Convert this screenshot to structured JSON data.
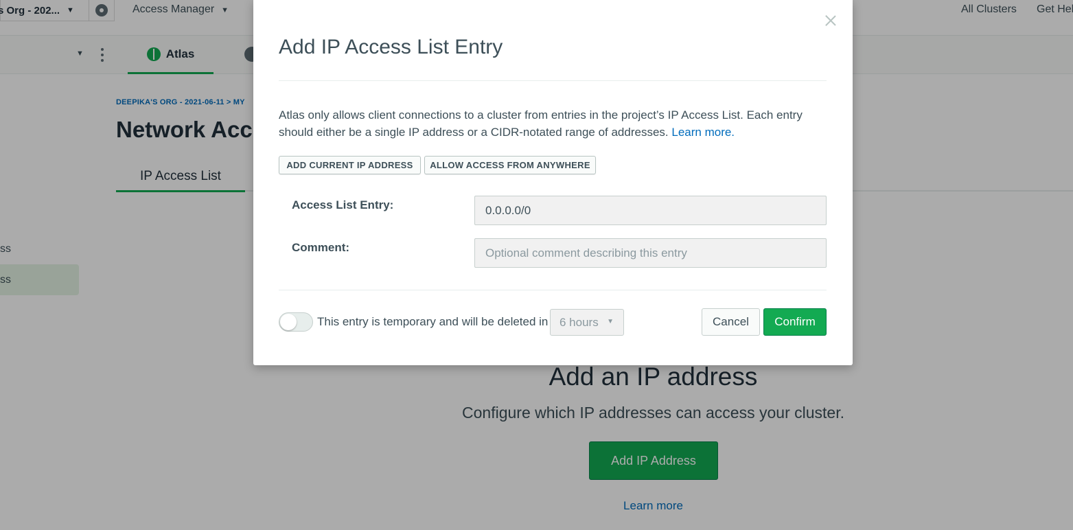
{
  "topbar": {
    "org_name": "s Org - 202...",
    "access_manager": "Access Manager",
    "all_clusters": "All Clusters",
    "get_help": "Get Hel"
  },
  "subnav": {
    "atlas_tab": "Atlas"
  },
  "page": {
    "breadcrumb": "DEEPIKA'S ORG - 2021-06-11 > MY",
    "title": "Network Acce",
    "tab_ip_access": "IP Access List",
    "sidebar_item_1": "ss",
    "sidebar_item_2": "ss",
    "empty_title": "Add an IP address",
    "empty_subtitle": "Configure which IP addresses can access your cluster.",
    "empty_button": "Add IP Address",
    "empty_link": "Learn more"
  },
  "modal": {
    "title": "Add IP Access List Entry",
    "description": "Atlas only allows client connections to a cluster from entries in the project’s IP Access List. Each entry should either be a single IP address or a CIDR-notated range of addresses.",
    "learn_more": "Learn more.",
    "add_current_ip": "ADD CURRENT IP ADDRESS",
    "allow_anywhere": "ALLOW ACCESS FROM ANYWHERE",
    "entry_label": "Access List Entry:",
    "entry_value": "0.0.0.0/0",
    "comment_label": "Comment:",
    "comment_placeholder": "Optional comment describing this entry",
    "temporary_text": "This entry is temporary and will be deleted in",
    "hours_value": "6 hours",
    "cancel": "Cancel",
    "confirm": "Confirm"
  },
  "colors": {
    "brand_green": "#13aa52",
    "link_blue": "#006cbc",
    "overlay": "rgba(0,0,0,0.33)"
  }
}
